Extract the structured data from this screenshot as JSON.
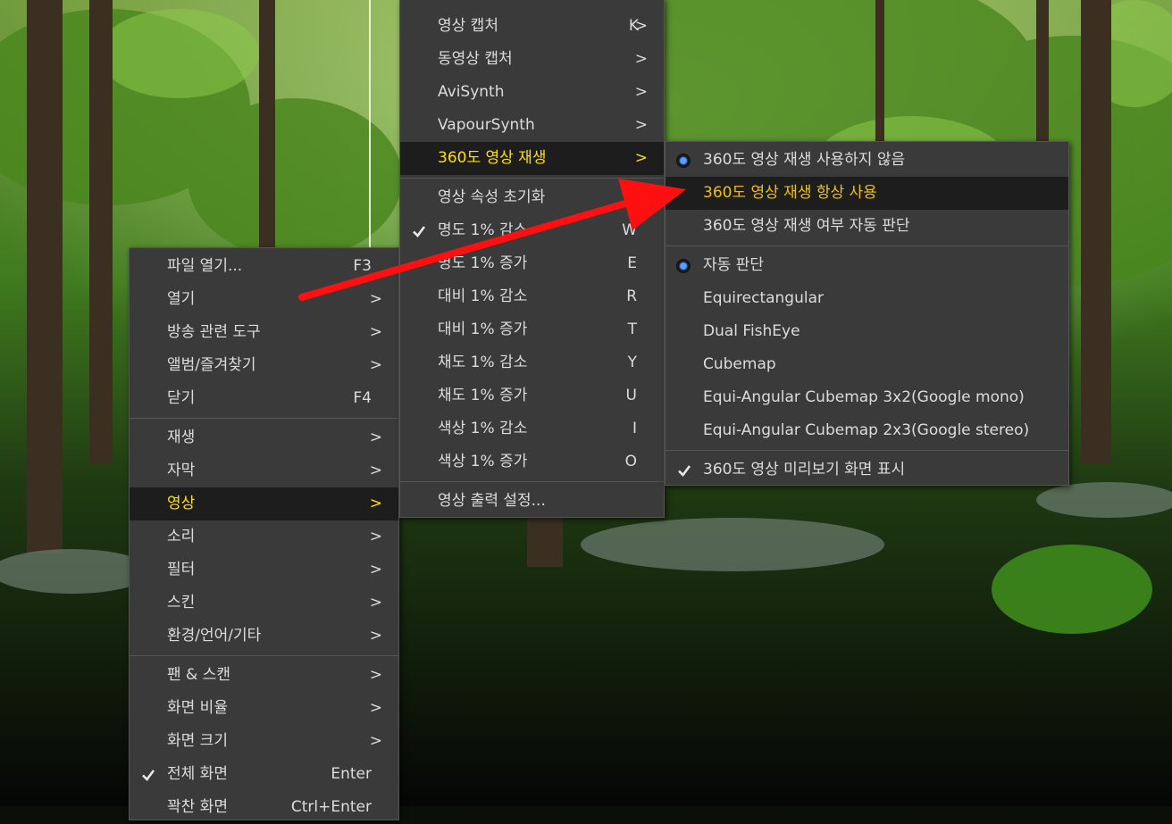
{
  "main_menu": {
    "items": [
      {
        "label": "파일 열기...",
        "shortcut": "F3"
      },
      {
        "label": "열기",
        "arrow": ">"
      },
      {
        "label": "방송 관련 도구",
        "arrow": ">"
      },
      {
        "label": "앨범/즐겨찾기",
        "arrow": ">"
      },
      {
        "label": "닫기",
        "shortcut": "F4"
      },
      {
        "label": "재생",
        "arrow": ">"
      },
      {
        "label": "자막",
        "arrow": ">"
      },
      {
        "label": "영상",
        "arrow": ">"
      },
      {
        "label": "소리",
        "arrow": ">"
      },
      {
        "label": "필터",
        "arrow": ">"
      },
      {
        "label": "스킨",
        "arrow": ">"
      },
      {
        "label": "환경/언어/기타",
        "arrow": ">"
      },
      {
        "label": "팬 & 스캔",
        "arrow": ">"
      },
      {
        "label": "화면 비율",
        "arrow": ">"
      },
      {
        "label": "화면 크기",
        "arrow": ">"
      },
      {
        "label": "전체 화면",
        "shortcut": "Enter"
      },
      {
        "label": "꽉찬 화면",
        "shortcut": "Ctrl+Enter"
      }
    ]
  },
  "video_menu": {
    "items": [
      {
        "label": "영상 캡처",
        "shortcut": "K",
        "arrow": ">"
      },
      {
        "label": "동영상 캡처",
        "arrow": ">"
      },
      {
        "label": "AviSynth",
        "arrow": ">"
      },
      {
        "label": "VapourSynth",
        "arrow": ">"
      },
      {
        "label": "360도 영상 재생",
        "arrow": ">"
      },
      {
        "label": "영상 속성 초기화",
        "shortcut": "Q"
      },
      {
        "label": "명도 1% 감소",
        "shortcut": "W"
      },
      {
        "label": "명도 1% 증가",
        "shortcut": "E"
      },
      {
        "label": "대비 1% 감소",
        "shortcut": "R"
      },
      {
        "label": "대비 1% 증가",
        "shortcut": "T"
      },
      {
        "label": "채도 1% 감소",
        "shortcut": "Y"
      },
      {
        "label": "채도 1% 증가",
        "shortcut": "U"
      },
      {
        "label": "색상 1% 감소",
        "shortcut": "I"
      },
      {
        "label": "색상 1% 증가",
        "shortcut": "O"
      },
      {
        "label": "영상 출력 설정..."
      }
    ]
  },
  "vr_menu": {
    "items": [
      {
        "label": "360도 영상 재생 사용하지 않음"
      },
      {
        "label": "360도 영상 재생 항상 사용"
      },
      {
        "label": "360도 영상 재생 여부 자동 판단"
      },
      {
        "label": "자동 판단"
      },
      {
        "label": "Equirectangular"
      },
      {
        "label": "Dual FishEye"
      },
      {
        "label": "Cubemap"
      },
      {
        "label": "Equi-Angular Cubemap 3x2(Google mono)"
      },
      {
        "label": "Equi-Angular Cubemap 2x3(Google stereo)"
      },
      {
        "label": "360도 영상 미리보기 화면 표시"
      }
    ]
  },
  "colors": {
    "menu_bg": "#3a3a3a",
    "highlight_bg": "#1d1d1d",
    "highlight_text": "#f2c200",
    "arrow": "#ff1010"
  }
}
